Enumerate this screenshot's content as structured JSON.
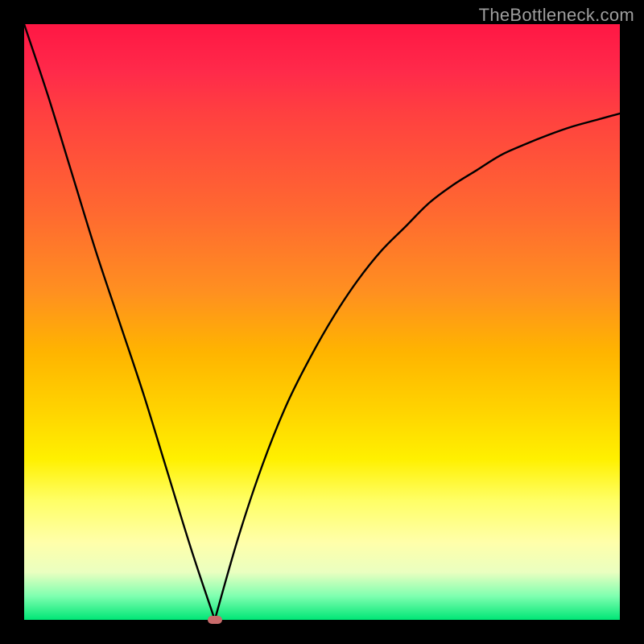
{
  "watermark": "TheBottleneck.com",
  "colors": {
    "page_bg": "#000000",
    "curve": "#000000",
    "marker": "#c96b6b",
    "watermark": "#9e9e9e"
  },
  "chart_data": {
    "type": "line",
    "title": "",
    "xlabel": "",
    "ylabel": "",
    "xlim": [
      0,
      100
    ],
    "ylim": [
      0,
      100
    ],
    "grid": false,
    "legend": false,
    "min_point": {
      "x": 32,
      "y": 0
    },
    "background_gradient": {
      "direction": "vertical",
      "stops": [
        {
          "pos": 0,
          "meaning": "worst",
          "hex": "#ff1744"
        },
        {
          "pos": 50,
          "meaning": "mid",
          "hex": "#ffb400"
        },
        {
          "pos": 80,
          "meaning": "ok",
          "hex": "#ffff88"
        },
        {
          "pos": 100,
          "meaning": "best",
          "hex": "#00e676"
        }
      ]
    },
    "series": [
      {
        "name": "left-branch",
        "x": [
          0,
          4,
          8,
          12,
          16,
          20,
          24,
          28,
          32
        ],
        "y": [
          100,
          88,
          75,
          62,
          50,
          38,
          25,
          12,
          0
        ]
      },
      {
        "name": "right-branch",
        "x": [
          32,
          36,
          40,
          44,
          48,
          52,
          56,
          60,
          64,
          68,
          72,
          76,
          80,
          84,
          88,
          92,
          96,
          100
        ],
        "y": [
          0,
          14,
          26,
          36,
          44,
          51,
          57,
          62,
          66,
          70,
          73,
          75.5,
          78,
          79.8,
          81.4,
          82.8,
          83.9,
          85
        ]
      }
    ]
  }
}
